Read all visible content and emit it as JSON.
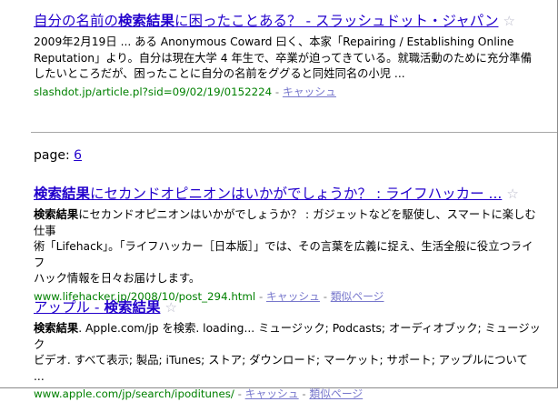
{
  "results": [
    {
      "title_pre": "自分の名前の",
      "title_bold": "検索結果",
      "title_post": "に困ったことある？ - スラッシュドット・ジャパン",
      "star": "☆",
      "snippet_lines": [
        "2009年2月19日 ... ある Anonymous Coward 曰く、本家「Repairing / Establishing Online",
        "Reputation」より。自分は現在大学 4 年生で、卒業が迫ってきている。就職活動のために充分準備",
        "したいところだが、困ったことに自分の名前をググると同姓同名の小児 ..."
      ],
      "url": "slashdot.jp/article.pl?sid=09/02/19/0152224",
      "separator": " - ",
      "cache_label": "キャッシュ"
    },
    {
      "title_bold": "検索結果",
      "title_post": "にセカンドオピニオンはいかがでしょうか？ : ライフハッカー ...",
      "star": "☆",
      "snippet_bold": "検索結果",
      "snippet_lines": [
        "にセカンドオピニオンはいかがでしょうか？ : ガジェットなどを駆使し、スマートに楽しむ仕事",
        "術「Lifehack」。「ライフハッカー［日本版］」では、その言葉を広義に捉え、生活全般に役立つライフ",
        "ハック情報を日々お届けします。"
      ],
      "url": "www.lifehacker.jp/2008/10/post_294.html",
      "separator": " - ",
      "cache_label": "キャッシュ",
      "similar_label": "類似ページ"
    },
    {
      "title_pre": "アップル - ",
      "title_bold": "検索結果",
      "star": "☆",
      "snippet_bold": "検索結果",
      "snippet_lines": [
        ". Apple.com/jp を検索. loading... ミュージック; Podcasts; オーディオブック; ミュージック",
        "ビデオ. すべて表示; 製品; iTunes; ストア; ダウンロード; マーケット; サポート; アップルについて ..."
      ],
      "url": "www.apple.com/jp/search/ipoditunes/",
      "separator": " - ",
      "cache_label": "キャッシュ",
      "similar_label": "類似ページ"
    }
  ],
  "pager": {
    "label": "page: ",
    "page_number": "6"
  }
}
